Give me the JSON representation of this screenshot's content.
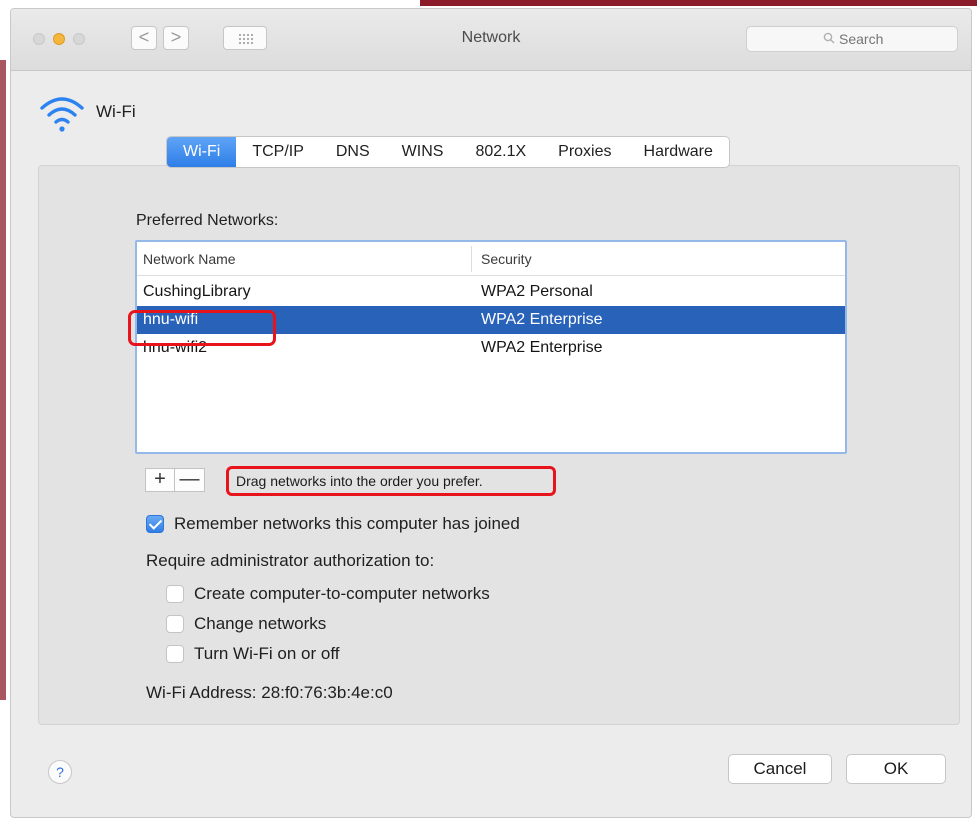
{
  "window": {
    "title": "Network"
  },
  "toolbar": {
    "back_glyph": "<",
    "forward_glyph": ">",
    "grid_icon": "grid-icon",
    "search_placeholder": "Search"
  },
  "service": {
    "name": "Wi-Fi",
    "icon": "wifi-icon"
  },
  "tabs": [
    {
      "label": "Wi-Fi",
      "active": true
    },
    {
      "label": "TCP/IP",
      "active": false
    },
    {
      "label": "DNS",
      "active": false
    },
    {
      "label": "WINS",
      "active": false
    },
    {
      "label": "802.1X",
      "active": false
    },
    {
      "label": "Proxies",
      "active": false
    },
    {
      "label": "Hardware",
      "active": false
    }
  ],
  "preferred": {
    "label": "Preferred Networks:",
    "columns": {
      "name": "Network Name",
      "security": "Security"
    },
    "rows": [
      {
        "name": "CushingLibrary",
        "security": "WPA2 Personal",
        "selected": false
      },
      {
        "name": "hnu-wifi",
        "security": "WPA2 Enterprise",
        "selected": true
      },
      {
        "name": "hnu-wifi2",
        "security": "WPA2 Enterprise",
        "selected": false
      }
    ],
    "add_glyph": "+",
    "remove_glyph": "—",
    "hint": "Drag networks into the order you prefer."
  },
  "options": {
    "remember_label": "Remember networks this computer has joined",
    "remember_checked": true,
    "require_label": "Require administrator authorization to:",
    "require_items": [
      {
        "label": "Create computer-to-computer networks",
        "checked": false
      },
      {
        "label": "Change networks",
        "checked": false
      },
      {
        "label": "Turn Wi-Fi on or off",
        "checked": false
      }
    ]
  },
  "address": {
    "label": "Wi-Fi Address:",
    "value": "28:f0:76:3b:4e:c0"
  },
  "footer": {
    "help_glyph": "?",
    "cancel_label": "Cancel",
    "ok_label": "OK"
  },
  "colors": {
    "accent": "#2e7ee8",
    "selection": "#2962b9",
    "annotation": "#e8141b",
    "frame": "#8b1d2b"
  }
}
